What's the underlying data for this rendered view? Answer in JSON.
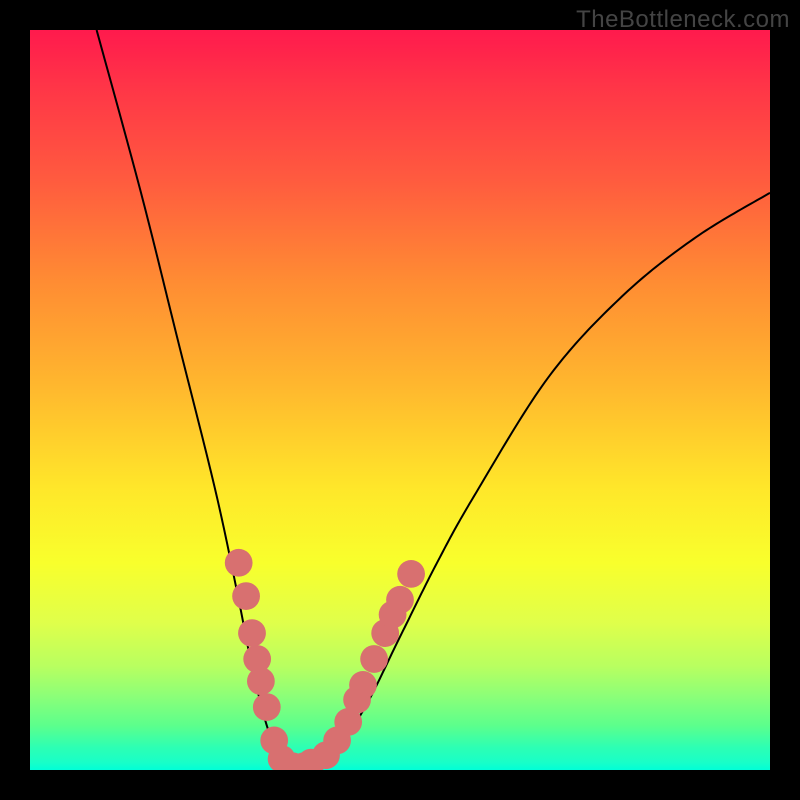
{
  "watermark": "TheBottleneck.com",
  "chart_data": {
    "type": "line",
    "title": "",
    "xlabel": "",
    "ylabel": "",
    "xlim": [
      0,
      100
    ],
    "ylim": [
      0,
      100
    ],
    "gradient_stops": [
      {
        "pos": 0,
        "color": "#ff1a4d"
      },
      {
        "pos": 8,
        "color": "#ff3647"
      },
      {
        "pos": 20,
        "color": "#ff5a3f"
      },
      {
        "pos": 34,
        "color": "#ff8c33"
      },
      {
        "pos": 48,
        "color": "#ffb72e"
      },
      {
        "pos": 62,
        "color": "#ffe72a"
      },
      {
        "pos": 72,
        "color": "#f8ff2c"
      },
      {
        "pos": 80,
        "color": "#e0ff4a"
      },
      {
        "pos": 86,
        "color": "#b8ff60"
      },
      {
        "pos": 90,
        "color": "#8cff78"
      },
      {
        "pos": 94,
        "color": "#5cff8c"
      },
      {
        "pos": 97,
        "color": "#2cffb4"
      },
      {
        "pos": 99,
        "color": "#18ffc8"
      },
      {
        "pos": 100,
        "color": "#00ffd8"
      }
    ],
    "series": [
      {
        "name": "curve-left",
        "x": [
          9,
          15,
          20,
          25,
          28,
          30,
          32,
          34,
          35
        ],
        "y": [
          100,
          78,
          58,
          38,
          24,
          14,
          6,
          1,
          0
        ]
      },
      {
        "name": "curve-right",
        "x": [
          37,
          40,
          45,
          50,
          55,
          60,
          70,
          80,
          90,
          100
        ],
        "y": [
          0,
          1,
          8,
          18,
          28,
          37,
          53,
          64,
          72,
          78
        ]
      }
    ],
    "markers": [
      {
        "x": 28.2,
        "y": 28.0,
        "r": 1.2
      },
      {
        "x": 29.2,
        "y": 23.5,
        "r": 1.2
      },
      {
        "x": 30.0,
        "y": 18.5,
        "r": 1.2
      },
      {
        "x": 30.7,
        "y": 15.0,
        "r": 1.2
      },
      {
        "x": 31.2,
        "y": 12.0,
        "r": 1.2
      },
      {
        "x": 32.0,
        "y": 8.5,
        "r": 1.2
      },
      {
        "x": 33.0,
        "y": 4.0,
        "r": 1.2
      },
      {
        "x": 34.0,
        "y": 1.5,
        "r": 1.2
      },
      {
        "x": 35.5,
        "y": 0.5,
        "r": 1.2
      },
      {
        "x": 37.0,
        "y": 0.5,
        "r": 1.2
      },
      {
        "x": 38.0,
        "y": 1.0,
        "r": 1.2
      },
      {
        "x": 40.0,
        "y": 2.0,
        "r": 1.2
      },
      {
        "x": 41.5,
        "y": 4.0,
        "r": 1.2
      },
      {
        "x": 43.0,
        "y": 6.5,
        "r": 1.2
      },
      {
        "x": 44.2,
        "y": 9.5,
        "r": 1.2
      },
      {
        "x": 45.0,
        "y": 11.5,
        "r": 1.2
      },
      {
        "x": 46.5,
        "y": 15.0,
        "r": 1.2
      },
      {
        "x": 48.0,
        "y": 18.5,
        "r": 1.2
      },
      {
        "x": 49.0,
        "y": 21.0,
        "r": 1.2
      },
      {
        "x": 50.0,
        "y": 23.0,
        "r": 1.2
      },
      {
        "x": 51.5,
        "y": 26.5,
        "r": 1.2
      }
    ],
    "marker_color": "#d87070"
  }
}
